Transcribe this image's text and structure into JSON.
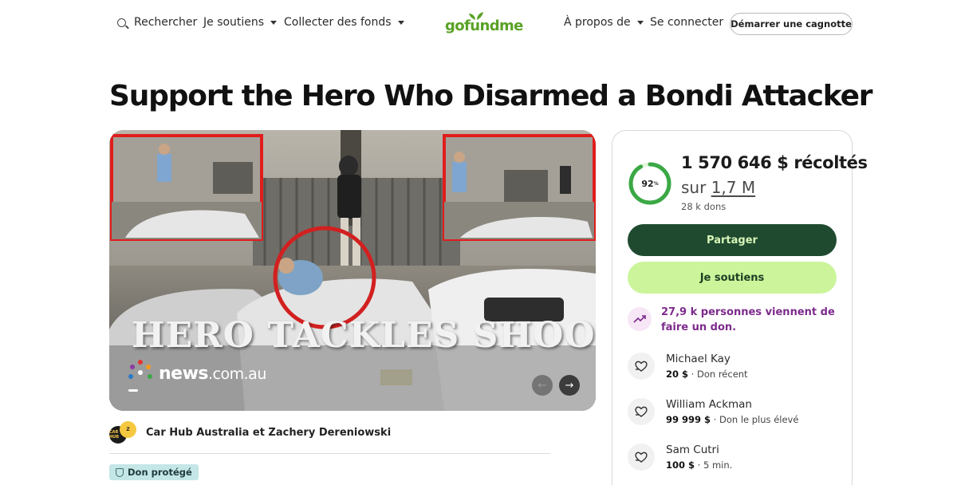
{
  "header": {
    "search_label": "Rechercher",
    "support_label": "Je soutiens",
    "fundraise_label": "Collecter des fonds",
    "logo_text": "gofundme",
    "about_label": "À propos de",
    "signin_label": "Se connecter",
    "start_label": "Démarrer une cagnotte"
  },
  "campaign": {
    "title": "Support the Hero Who Disarmed a Bondi Attacker",
    "media_overlay": "HERO TACKLES SHOOTER",
    "media_brand_main": "news",
    "media_brand_domain": ".com.au",
    "organizer_name": "Car Hub Australia et Zachery Dereniowski",
    "organizer_avatar_1": "CAR HUB",
    "organizer_avatar_2": "Z",
    "protected_badge": "Don protégé"
  },
  "donation": {
    "progress_value": 92,
    "progress_pct_label": "92",
    "progress_pct_sign": "%",
    "raised_label": "1 570 646 $ récoltés",
    "goal_prefix": "sur ",
    "goal_amount": "1,7 M",
    "donations_count": "28 k dons",
    "share_button": "Partager",
    "donate_button": "Je soutiens",
    "trend_text": "27,9 k personnes viennent de faire un don.",
    "accent_color": "#ccf59b",
    "donors": [
      {
        "name": "Michael Kay",
        "amount": "20 $",
        "note": " · Don récent"
      },
      {
        "name": "William Ackman",
        "amount": "99 999 $",
        "note": " · Don le plus élevé"
      },
      {
        "name": "Sam Cutri",
        "amount": "100 $",
        "note": " · 5 min."
      }
    ]
  }
}
